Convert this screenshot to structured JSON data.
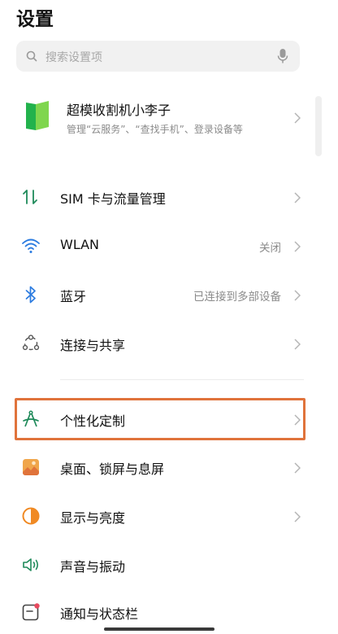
{
  "header": {
    "title": "设置"
  },
  "search": {
    "placeholder": "搜索设置项"
  },
  "account": {
    "name": "超模收割机小李子",
    "subtitle": "管理“云服务”、“查找手机”、登录设备等"
  },
  "items": [
    {
      "label": "SIM 卡与流量管理",
      "value": ""
    },
    {
      "label": "WLAN",
      "value": "关闭"
    },
    {
      "label": "蓝牙",
      "value": "已连接到多部设备"
    },
    {
      "label": "连接与共享",
      "value": ""
    },
    {
      "label": "个性化定制",
      "value": ""
    },
    {
      "label": "桌面、锁屏与息屏",
      "value": ""
    },
    {
      "label": "显示与亮度",
      "value": ""
    },
    {
      "label": "声音与振动",
      "value": ""
    },
    {
      "label": "通知与状态栏",
      "value": ""
    }
  ],
  "highlight": {
    "color": "#e0733b",
    "target": "个性化定制"
  }
}
